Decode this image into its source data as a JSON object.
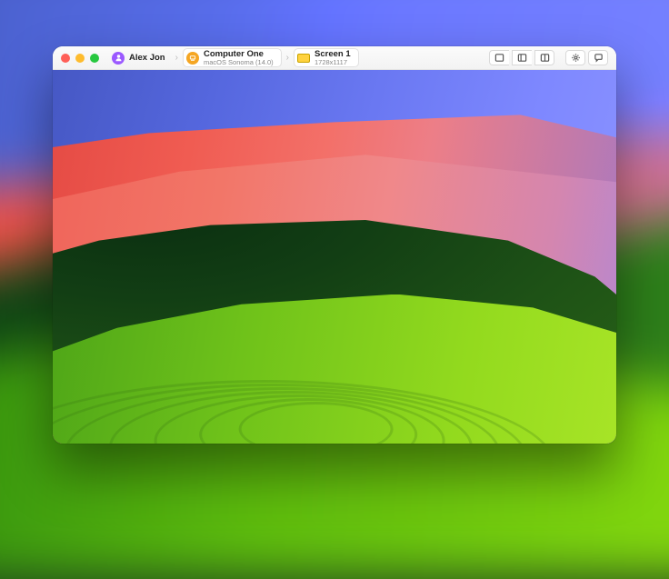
{
  "user": {
    "name": "Alex Jon"
  },
  "computer": {
    "name": "Computer One",
    "os": "macOS Sonoma (14.0)"
  },
  "screen": {
    "name": "Screen 1",
    "resolution": "1728x1117"
  }
}
